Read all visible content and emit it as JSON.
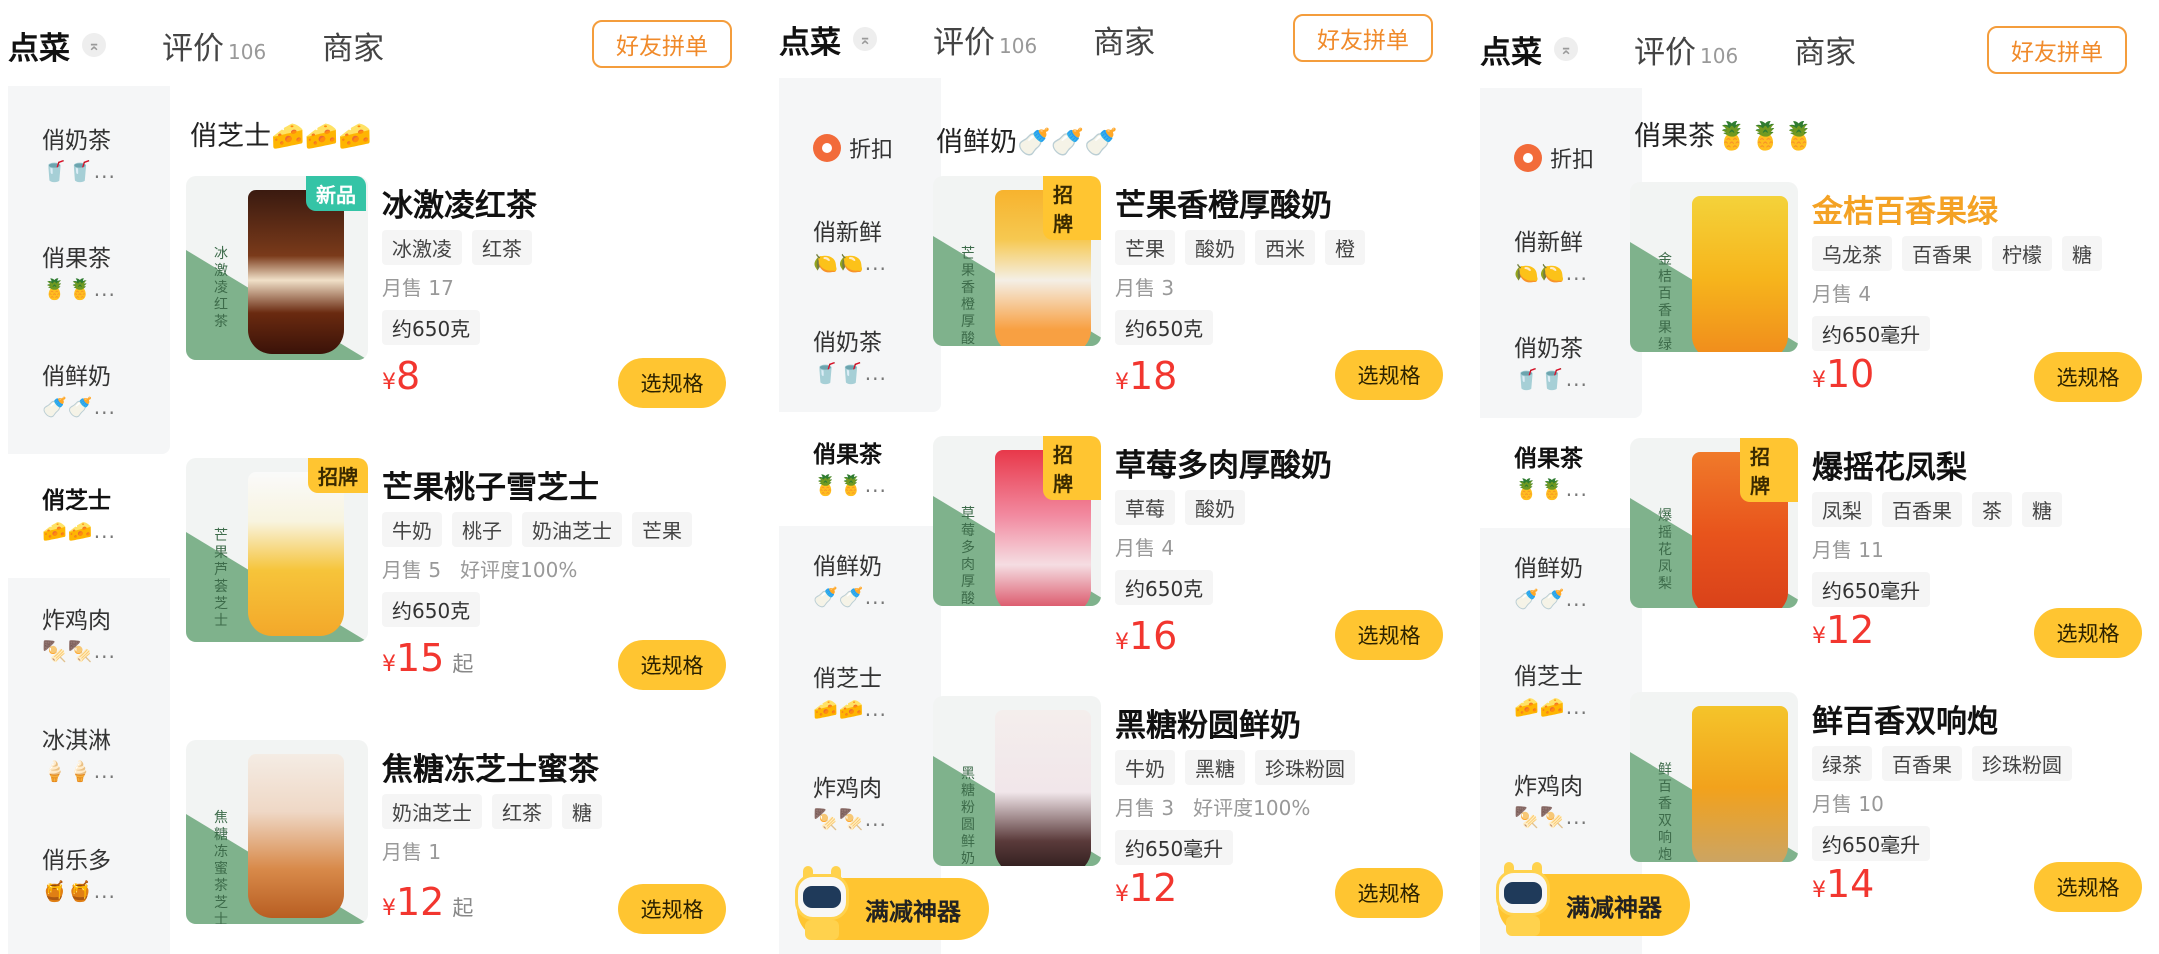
{
  "colors": {
    "accent": "#ffc531",
    "price": "#f2362f",
    "orange": "#f08a2a",
    "green_tri": "#7fb28c",
    "badge_new": "#35c4a6"
  },
  "tabs": {
    "order": "点菜",
    "reviews": "评价",
    "review_count": "106",
    "merchant": "商家",
    "pin_icon": "⌅"
  },
  "group_order_label": "好友拼单",
  "select_label": "选规格",
  "promo_label": "满减神器",
  "panels": [
    {
      "sidebar": [
        {
          "name": "俏奶茶",
          "emoji": "🥤🥤..."
        },
        {
          "name": "俏果茶",
          "emoji": "🍍🍍..."
        },
        {
          "name": "俏鲜奶",
          "emoji": "🍼🍼..."
        },
        {
          "name": "俏芝士",
          "emoji": "🧀🧀..."
        },
        {
          "name": "炸鸡肉",
          "emoji": "🍢🍢..."
        },
        {
          "name": "冰淇淋",
          "emoji": "🍦🍦..."
        },
        {
          "name": "俏乐多",
          "emoji": "🍯🍯..."
        }
      ],
      "section_title": "俏芝士🧀🧀🧀",
      "products": [
        {
          "name": "冰激凌红茶",
          "badge": "新品",
          "tags": [
            "冰激凌",
            "红茶"
          ],
          "sales": "月售 17",
          "rating": "",
          "spec": "约650克",
          "price": "8",
          "qi": "",
          "vert": "冰激凌红茶"
        },
        {
          "name": "芒果桃子雪芝士",
          "badge": "招牌",
          "tags": [
            "牛奶",
            "桃子",
            "奶油芝士",
            "芒果"
          ],
          "sales": "月售 5",
          "rating": "好评度100%",
          "spec": "约650克",
          "price": "15",
          "qi": "起",
          "vert": "芒果芦荟芝士"
        },
        {
          "name": "焦糖冻芝士蜜茶",
          "badge": "",
          "tags": [
            "奶油芝士",
            "红茶",
            "糖"
          ],
          "sales": "月售 1",
          "rating": "",
          "spec": "",
          "price": "12",
          "qi": "起",
          "vert": "焦糖冻蜜茶芝士"
        }
      ]
    },
    {
      "sidebar": [
        {
          "name": "折扣",
          "emoji": ""
        },
        {
          "name": "俏新鲜",
          "emoji": "🍋🍋..."
        },
        {
          "name": "俏奶茶",
          "emoji": "🥤🥤..."
        },
        {
          "name": "俏果茶",
          "emoji": "🍍🍍..."
        },
        {
          "name": "俏鲜奶",
          "emoji": "🍼🍼..."
        },
        {
          "name": "俏芝士",
          "emoji": "🧀🧀..."
        },
        {
          "name": "炸鸡肉",
          "emoji": "🍢🍢..."
        }
      ],
      "section_title": "俏鲜奶🍼🍼🍼",
      "products": [
        {
          "name": "芒果香橙厚酸奶",
          "badge": "招牌",
          "tags": [
            "芒果",
            "酸奶",
            "西米",
            "橙"
          ],
          "sales": "月售 3",
          "rating": "",
          "spec": "约650克",
          "price": "18",
          "qi": "",
          "vert": "芒果香橙厚酸奶"
        },
        {
          "name": "草莓多肉厚酸奶",
          "badge": "招牌",
          "tags": [
            "草莓",
            "酸奶"
          ],
          "sales": "月售 4",
          "rating": "",
          "spec": "约650克",
          "price": "16",
          "qi": "",
          "vert": "草莓多肉厚酸奶"
        },
        {
          "name": "黑糖粉圆鲜奶",
          "badge": "",
          "tags": [
            "牛奶",
            "黑糖",
            "珍珠粉圆"
          ],
          "sales": "月售 3",
          "rating": "好评度100%",
          "spec": "约650毫升",
          "price": "12",
          "qi": "",
          "vert": "黑糖粉圆鲜奶"
        }
      ]
    },
    {
      "sidebar": [
        {
          "name": "折扣",
          "emoji": ""
        },
        {
          "name": "俏新鲜",
          "emoji": "🍋🍋..."
        },
        {
          "name": "俏奶茶",
          "emoji": "🥤🥤..."
        },
        {
          "name": "俏果茶",
          "emoji": "🍍🍍..."
        },
        {
          "name": "俏鲜奶",
          "emoji": "🍼🍼..."
        },
        {
          "name": "俏芝士",
          "emoji": "🧀🧀..."
        },
        {
          "name": "炸鸡肉",
          "emoji": "🍢🍢..."
        }
      ],
      "section_title": "俏果茶🍍🍍🍍",
      "products": [
        {
          "name": "金桔百香果绿",
          "badge": "",
          "tags": [
            "乌龙茶",
            "百香果",
            "柠檬",
            "糖"
          ],
          "sales": "月售 4",
          "rating": "",
          "spec": "约650毫升",
          "price": "10",
          "qi": "",
          "vert": "金桔百香果绿"
        },
        {
          "name": "爆摇花凤梨",
          "badge": "招牌",
          "tags": [
            "凤梨",
            "百香果",
            "茶",
            "糖"
          ],
          "sales": "月售 11",
          "rating": "",
          "spec": "约650毫升",
          "price": "12",
          "qi": "",
          "vert": "爆摇花凤梨"
        },
        {
          "name": "鲜百香双响炮",
          "badge": "",
          "tags": [
            "绿茶",
            "百香果",
            "珍珠粉圆"
          ],
          "sales": "月售 10",
          "rating": "",
          "spec": "约650毫升",
          "price": "14",
          "qi": "",
          "vert": "鲜百香双响炮"
        }
      ]
    }
  ]
}
